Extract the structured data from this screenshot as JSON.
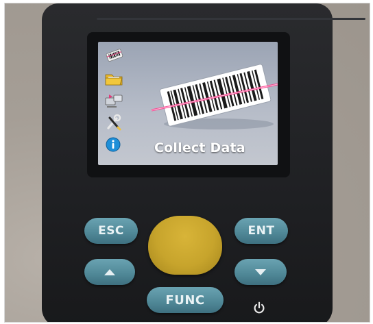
{
  "screen": {
    "title": "Collect Data",
    "selected_item_icon": "barcode-scan-icon"
  },
  "menu": {
    "icons": [
      "barcode-tag-icon",
      "folder-icon",
      "device-transfer-icon",
      "tools-icon",
      "info-icon"
    ]
  },
  "keypad": {
    "esc_label": "ESC",
    "ent_label": "ENT",
    "func_label": "FUNC",
    "up_icon": "up-arrow-icon",
    "down_icon": "down-arrow-icon",
    "power_icon": "power-icon",
    "trigger_color": "#c9a62d",
    "key_color": "#5a92a1"
  }
}
